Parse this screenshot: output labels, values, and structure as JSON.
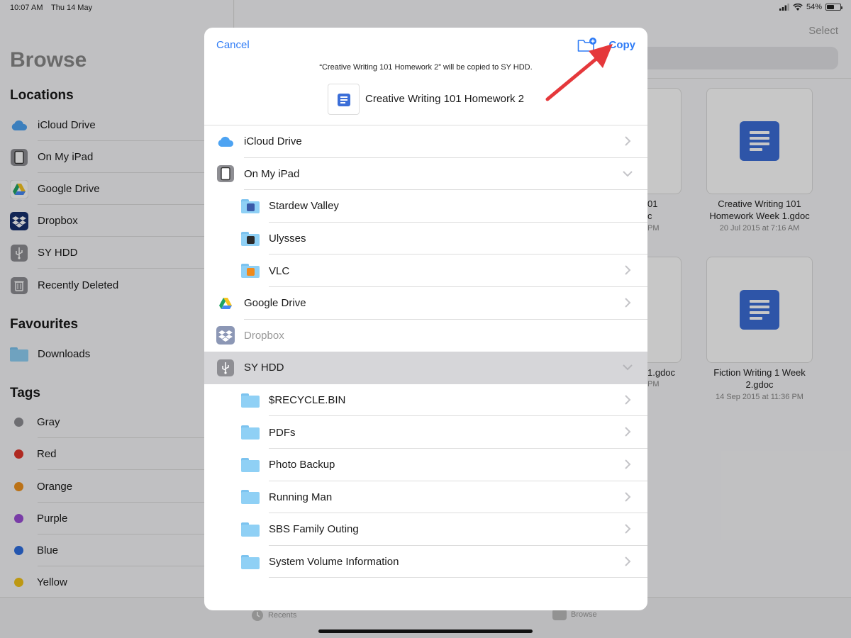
{
  "status_bar": {
    "time": "10:07 AM",
    "date": "Thu 14 May",
    "battery": "54%"
  },
  "sidebar": {
    "title": "Browse",
    "locations_title": "Locations",
    "locations": [
      {
        "label": "iCloud Drive",
        "icon": "icloud-icon"
      },
      {
        "label": "On My iPad",
        "icon": "ipad-icon"
      },
      {
        "label": "Google Drive",
        "icon": "google-drive-icon"
      },
      {
        "label": "Dropbox",
        "icon": "dropbox-icon"
      },
      {
        "label": "SY HDD",
        "icon": "usb-drive-icon"
      },
      {
        "label": "Recently Deleted",
        "icon": "trash-icon"
      }
    ],
    "favourites_title": "Favourites",
    "favourites": [
      {
        "label": "Downloads",
        "icon": "folder-icon"
      }
    ],
    "tags_title": "Tags",
    "tags": [
      {
        "label": "Gray",
        "color": "#8e8e93"
      },
      {
        "label": "Red",
        "color": "#e0352b"
      },
      {
        "label": "Orange",
        "color": "#f0931e"
      },
      {
        "label": "Purple",
        "color": "#9b4ed6"
      },
      {
        "label": "Blue",
        "color": "#2f6fe0"
      },
      {
        "label": "Yellow",
        "color": "#f2c318"
      }
    ]
  },
  "main": {
    "select_label": "Select",
    "files": [
      {
        "name": "Creative Writing 101 Homework Week 1.gdoc",
        "date": "20 Jul 2015 at 7:16 AM"
      },
      {
        "name": "Fiction Writing 1 Week 2.gdoc",
        "date": "14 Sep 2015 at 11:36 PM"
      }
    ],
    "clipped": {
      "a1": "01",
      "a2": "c",
      "a3": "PM",
      "b1": "1.gdoc",
      "b2": "PM"
    }
  },
  "tabbar": {
    "recents": "Recents",
    "browse": "Browse"
  },
  "modal": {
    "cancel_label": "Cancel",
    "copy_label": "Copy",
    "message": "“Creative Writing 101 Homework 2” will be copied to SY HDD.",
    "document_title": "Creative Writing 101 Homework 2",
    "rows": [
      {
        "label": "iCloud Drive",
        "icon": "icloud-icon",
        "level": 0,
        "chevron": "right"
      },
      {
        "label": "On My iPad",
        "icon": "ipad-icon",
        "level": 0,
        "chevron": "down"
      },
      {
        "label": "Stardew Valley",
        "icon": "stardew-folder-icon",
        "level": 1,
        "chevron": "none"
      },
      {
        "label": "Ulysses",
        "icon": "ulysses-folder-icon",
        "level": 1,
        "chevron": "none"
      },
      {
        "label": "VLC",
        "icon": "vlc-folder-icon",
        "level": 1,
        "chevron": "right"
      },
      {
        "label": "Google Drive",
        "icon": "google-drive-icon",
        "level": 0,
        "chevron": "right"
      },
      {
        "label": "Dropbox",
        "icon": "dropbox-icon",
        "level": 0,
        "chevron": "none"
      },
      {
        "label": "SY HDD",
        "icon": "usb-drive-icon",
        "level": 0,
        "chevron": "down"
      },
      {
        "label": "$RECYCLE.BIN",
        "icon": "folder-icon",
        "level": 1,
        "chevron": "right"
      },
      {
        "label": "PDFs",
        "icon": "folder-icon",
        "level": 1,
        "chevron": "right"
      },
      {
        "label": "Photo Backup",
        "icon": "folder-icon",
        "level": 1,
        "chevron": "right"
      },
      {
        "label": "Running Man",
        "icon": "folder-icon",
        "level": 1,
        "chevron": "right"
      },
      {
        "label": "SBS Family Outing",
        "icon": "folder-icon",
        "level": 1,
        "chevron": "right"
      },
      {
        "label": "System Volume Information",
        "icon": "folder-icon",
        "level": 1,
        "chevron": "right"
      }
    ]
  },
  "colors": {
    "accent": "#2f7cf6",
    "doc_blue": "#3b6ed8",
    "folder": "#8fd0f5",
    "annotation_arrow": "#e5383b"
  }
}
